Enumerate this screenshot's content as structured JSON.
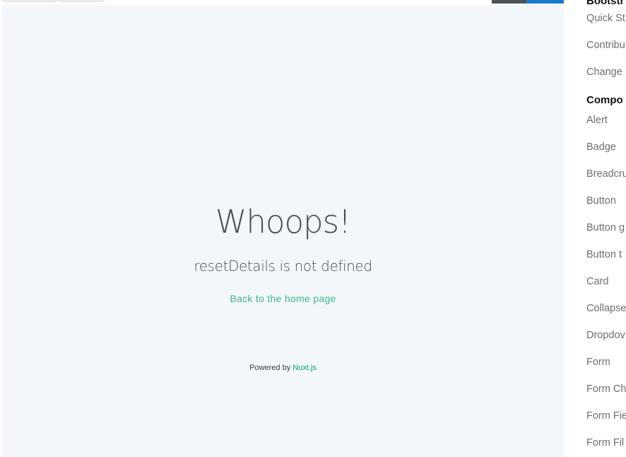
{
  "error": {
    "title": "Whoops!",
    "message": "resetDetails is not defined",
    "home_link": "Back to the home page",
    "powered_prefix": "Powered by",
    "powered_link": "Nuxt.js"
  },
  "sidebar": {
    "heading_top": "Bootstr",
    "items_top": [
      "Quick St",
      "Contribu",
      "Change"
    ],
    "heading_components": "Compo",
    "components": [
      "Alert",
      "Badge",
      "Breadcru",
      "Button",
      "Button g",
      "Button t",
      "Card",
      "Collapse",
      "Dropdov",
      "Form",
      "Form Ch",
      "Form Fie",
      "Form Fil"
    ]
  },
  "colors": {
    "panel_bg": "#f3f6fa",
    "link_green": "#41b883",
    "nuxt_green": "#00a86b",
    "accent_blue": "#1d7ad1"
  }
}
